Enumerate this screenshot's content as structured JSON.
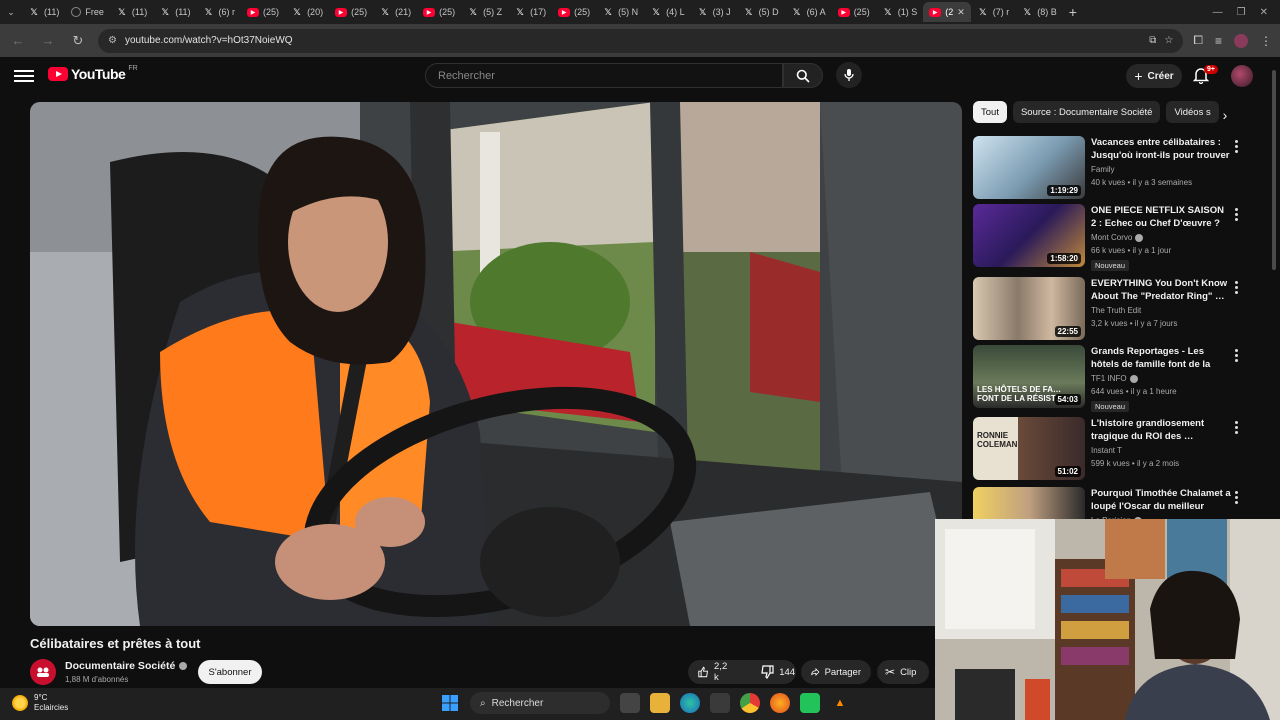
{
  "browser": {
    "tabs": [
      {
        "icon": "x-icon",
        "label": "(11)"
      },
      {
        "icon": "free-icon",
        "label": "Free"
      },
      {
        "icon": "x-icon",
        "label": "(11)"
      },
      {
        "icon": "x-icon",
        "label": "(11)"
      },
      {
        "icon": "x-icon",
        "label": "(6) r"
      },
      {
        "icon": "youtube-icon",
        "label": "(25)"
      },
      {
        "icon": "x-icon",
        "label": "(20)"
      },
      {
        "icon": "youtube-icon",
        "label": "(25)"
      },
      {
        "icon": "x-icon",
        "label": "(21)"
      },
      {
        "icon": "youtube-icon",
        "label": "(25)"
      },
      {
        "icon": "x-icon",
        "label": "(5) Z"
      },
      {
        "icon": "x-icon",
        "label": "(17)"
      },
      {
        "icon": "youtube-icon",
        "label": "(25)"
      },
      {
        "icon": "x-icon",
        "label": "(5) N"
      },
      {
        "icon": "x-icon",
        "label": "(4) L"
      },
      {
        "icon": "x-icon",
        "label": "(3) J"
      },
      {
        "icon": "x-icon",
        "label": "(5) D"
      },
      {
        "icon": "x-icon",
        "label": "(6) A"
      },
      {
        "icon": "youtube-icon",
        "label": "(25)"
      },
      {
        "icon": "x-icon",
        "label": "(1) S"
      },
      {
        "icon": "youtube-icon",
        "label": "(2",
        "active": true
      },
      {
        "icon": "x-icon",
        "label": "(7) r"
      },
      {
        "icon": "x-icon",
        "label": "(8) B"
      }
    ],
    "new_tab": "+",
    "url": "youtube.com/watch?v=hOt37NoieWQ"
  },
  "youtube": {
    "logo_text": "YouTube",
    "logo_country": "FR",
    "search_placeholder": "Rechercher",
    "create_label": "Créer",
    "notif_count": "9+"
  },
  "video": {
    "title": "Célibataires et prêtes à tout",
    "channel": "Documentaire Société",
    "subscribers": "1,88 M d'abonnés",
    "subscribe_label": "S'abonner",
    "likes": "2,2 k",
    "dislikes": "144",
    "share_label": "Partager",
    "clip_label": "Clip"
  },
  "filters": [
    "Tout",
    "Source : Documentaire Société",
    "Vidéos s"
  ],
  "recommendations": [
    {
      "title": "Vacances entre célibataires : Jusqu'où iront-ils pour trouver …",
      "channel": "Family",
      "verified": false,
      "meta": "40 k vues • il y a 3 semaines",
      "duration": "1:19:29",
      "badge": "",
      "thumb": "sky"
    },
    {
      "title": "ONE PIECE NETFLIX SAISON 2 : Echec ou Chef D'œuvre ? …",
      "channel": "Mont Corvo",
      "verified": true,
      "meta": "66 k vues • il y a 1 jour",
      "duration": "1:58:20",
      "badge": "Nouveau",
      "thumb": "purple"
    },
    {
      "title": "EVERYTHING You Don't Know About The \"Predator Ring\" …",
      "channel": "The Truth Edit",
      "verified": false,
      "meta": "3,2 k vues • il y a 7 jours",
      "duration": "22:55",
      "badge": "",
      "thumb": "faces"
    },
    {
      "title": "Grands Reportages - Les hôtels de famille font de la résistanc…",
      "channel": "TF1 INFO",
      "verified": true,
      "meta": "644 vues • il y a 1 heure",
      "duration": "54:03",
      "badge": "Nouveau",
      "thumb": "hotel",
      "thumb_text": "LES HÔTELS DE FA… FONT DE LA RÉSIST…"
    },
    {
      "title": "L'histoire grandiosement tragique du ROI des …",
      "channel": "Instant T",
      "verified": false,
      "meta": "599 k vues • il y a 2 mois",
      "duration": "51:02",
      "badge": "",
      "thumb": "coleman",
      "thumb_text": "RONNIE COLEMAN"
    },
    {
      "title": "Pourquoi Timothée Chalamet a loupé l'Oscar du meilleur acteur",
      "channel": "Le Parisien",
      "verified": true,
      "meta": "",
      "duration": "",
      "badge": "",
      "thumb": "scar"
    }
  ],
  "taskbar": {
    "temperature": "9°C",
    "condition": "Eclaircies",
    "search_label": "Rechercher"
  }
}
